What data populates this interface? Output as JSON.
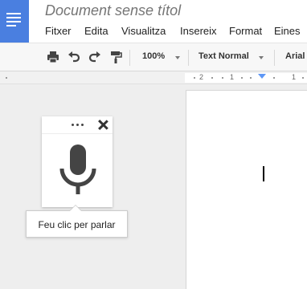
{
  "document": {
    "title": "Document sense títol"
  },
  "menu": [
    "Fitxer",
    "Edita",
    "Visualitza",
    "Insereix",
    "Format",
    "Eines"
  ],
  "toolbar": {
    "icons": [
      "print-icon",
      "undo-icon",
      "redo-icon",
      "paint-format-icon"
    ],
    "zoom": "100%",
    "style": "Text Normal",
    "font": "Arial"
  },
  "ruler": {
    "labels": [
      "2",
      "1",
      "1"
    ]
  },
  "voice_typing": {
    "tooltip": "Feu clic per parlar",
    "icons": [
      "more-icon",
      "close-icon",
      "microphone-icon"
    ]
  },
  "colors": {
    "brand": "#4a7fe0",
    "ruler_marker": "#5e97f6",
    "microphone": "#444444"
  }
}
